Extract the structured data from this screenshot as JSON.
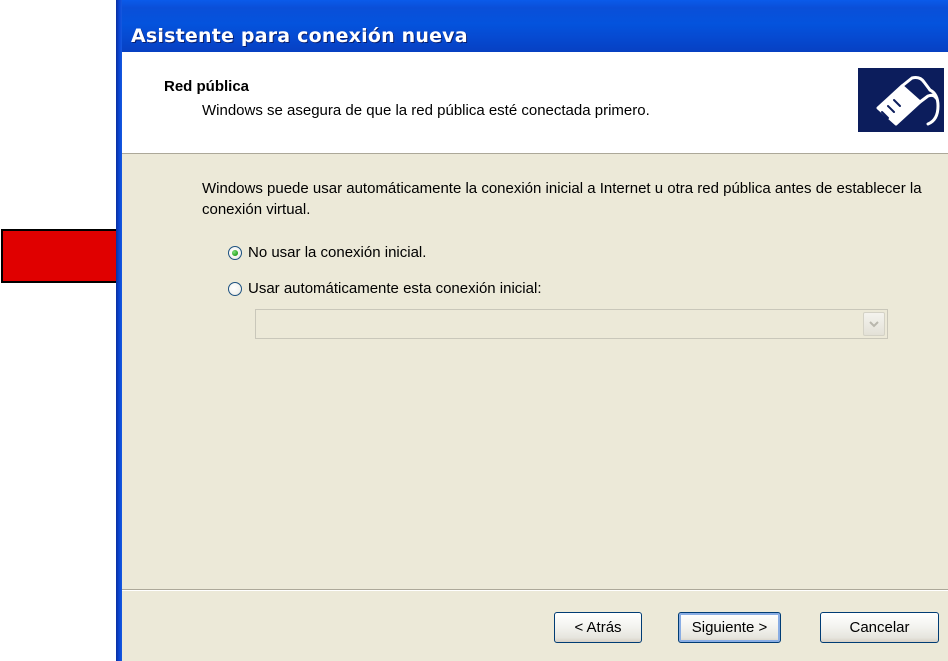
{
  "window": {
    "title": "Asistente para conexión nueva"
  },
  "header": {
    "title": "Red pública",
    "subtitle": "Windows se asegura de que la red pública esté conectada primero.",
    "icon": "network-cable-icon"
  },
  "body": {
    "description": "Windows puede usar automáticamente la conexión inicial a Internet u otra red pública antes de establecer la conexión virtual.",
    "options": [
      {
        "label": "No usar la conexión inicial.",
        "selected": true
      },
      {
        "label": "Usar automáticamente esta conexión inicial:",
        "selected": false
      }
    ],
    "connection_select": {
      "value": "",
      "enabled": false
    }
  },
  "buttons": {
    "back": "< Atrás",
    "next": "Siguiente >",
    "cancel": "Cancelar"
  },
  "annotation": {
    "icon": "red-arrow-icon",
    "color": "#e00000"
  },
  "colors": {
    "titlebar": "#0453dd",
    "dialog_bg": "#ece9d8",
    "radio_selected": "#26a41e"
  }
}
